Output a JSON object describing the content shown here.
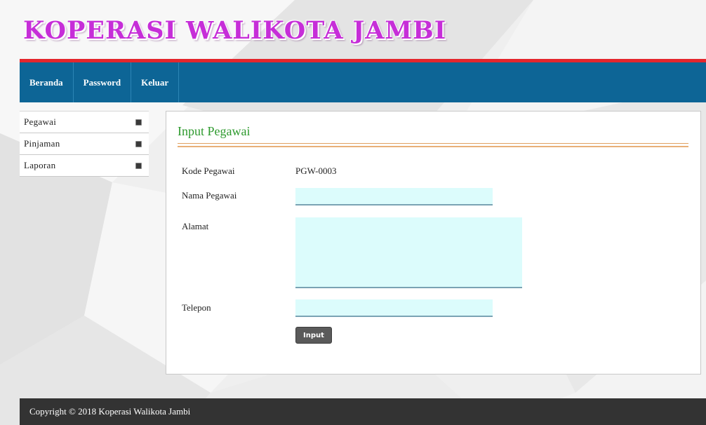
{
  "header": {
    "site_title": "KOPERASI WALIKOTA JAMBI"
  },
  "nav": {
    "items": [
      {
        "label": "Beranda"
      },
      {
        "label": "Password"
      },
      {
        "label": "Keluar"
      }
    ]
  },
  "sidebar": {
    "items": [
      {
        "label": "Pegawai",
        "icon": "bullet-icon"
      },
      {
        "label": "Pinjaman",
        "icon": "bullet-icon"
      },
      {
        "label": "Laporan",
        "icon": "bullet-icon"
      }
    ]
  },
  "form": {
    "title": "Input Pegawai",
    "kode_label": "Kode Pegawai",
    "kode_value": "PGW-0003",
    "nama_label": "Nama Pegawai",
    "nama_value": "",
    "alamat_label": "Alamat",
    "alamat_value": "",
    "telepon_label": "Telepon",
    "telepon_value": "",
    "submit_label": "Input"
  },
  "footer": {
    "text": "Copyright © 2018 Koperasi Walikota Jambi"
  },
  "colors": {
    "title_magenta": "#c62ed8",
    "nav_blue": "#0d6596",
    "accent_red": "#e4262d",
    "panel_title_green": "#2e9a2e",
    "field_bg": "#dcfcfc",
    "footer_bg": "#333333"
  }
}
